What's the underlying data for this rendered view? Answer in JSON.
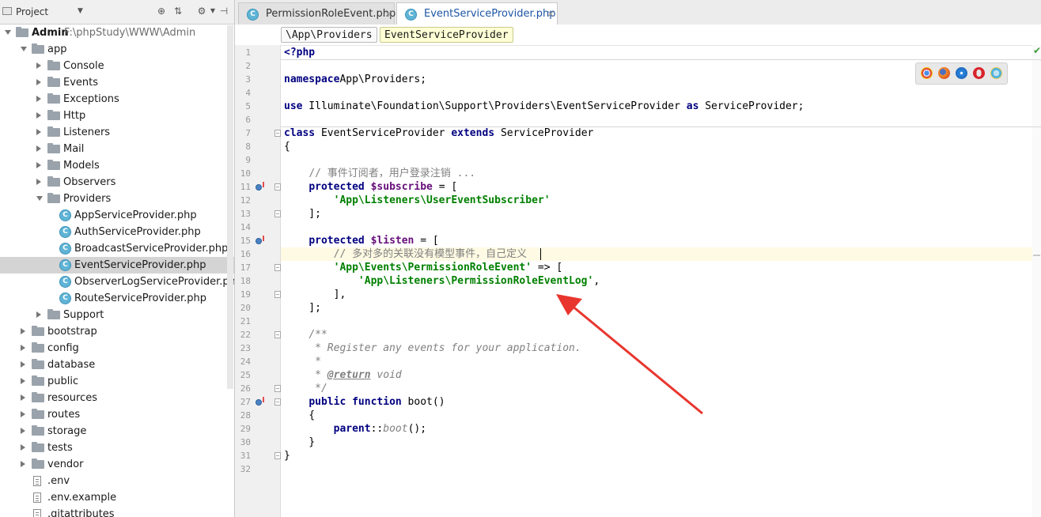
{
  "project_panel": {
    "title": "Project",
    "tree": [
      {
        "label": "Admin",
        "path": "F:\\phpStudy\\WWW\\Admin",
        "type": "folder",
        "open": true,
        "depth": 0,
        "root": true
      },
      {
        "label": "app",
        "type": "folder",
        "open": true,
        "depth": 1
      },
      {
        "label": "Console",
        "type": "folder",
        "open": false,
        "depth": 2
      },
      {
        "label": "Events",
        "type": "folder",
        "open": false,
        "depth": 2
      },
      {
        "label": "Exceptions",
        "type": "folder",
        "open": false,
        "depth": 2
      },
      {
        "label": "Http",
        "type": "folder",
        "open": false,
        "depth": 2
      },
      {
        "label": "Listeners",
        "type": "folder",
        "open": false,
        "depth": 2
      },
      {
        "label": "Mail",
        "type": "folder",
        "open": false,
        "depth": 2
      },
      {
        "label": "Models",
        "type": "folder",
        "open": false,
        "depth": 2
      },
      {
        "label": "Observers",
        "type": "folder",
        "open": false,
        "depth": 2
      },
      {
        "label": "Providers",
        "type": "folder",
        "open": true,
        "depth": 2
      },
      {
        "label": "AppServiceProvider.php",
        "type": "class",
        "depth": 3
      },
      {
        "label": "AuthServiceProvider.php",
        "type": "class",
        "depth": 3
      },
      {
        "label": "BroadcastServiceProvider.php",
        "type": "class",
        "depth": 3
      },
      {
        "label": "EventServiceProvider.php",
        "type": "class",
        "depth": 3,
        "selected": true
      },
      {
        "label": "ObserverLogServiceProvider.php",
        "type": "class",
        "depth": 3
      },
      {
        "label": "RouteServiceProvider.php",
        "type": "class",
        "depth": 3
      },
      {
        "label": "Support",
        "type": "folder",
        "open": false,
        "depth": 2
      },
      {
        "label": "bootstrap",
        "type": "folder",
        "open": false,
        "depth": 1
      },
      {
        "label": "config",
        "type": "folder",
        "open": false,
        "depth": 1
      },
      {
        "label": "database",
        "type": "folder",
        "open": false,
        "depth": 1
      },
      {
        "label": "public",
        "type": "folder",
        "open": false,
        "depth": 1
      },
      {
        "label": "resources",
        "type": "folder",
        "open": false,
        "depth": 1
      },
      {
        "label": "routes",
        "type": "folder",
        "open": false,
        "depth": 1
      },
      {
        "label": "storage",
        "type": "folder",
        "open": false,
        "depth": 1
      },
      {
        "label": "tests",
        "type": "folder",
        "open": false,
        "depth": 1
      },
      {
        "label": "vendor",
        "type": "folder",
        "open": false,
        "depth": 1
      },
      {
        "label": ".env",
        "type": "file",
        "depth": 1
      },
      {
        "label": ".env.example",
        "type": "file",
        "depth": 1
      },
      {
        "label": ".gitattributes",
        "type": "file",
        "depth": 1
      }
    ]
  },
  "tabs": [
    {
      "label": "PermissionRoleEvent.php",
      "active": false
    },
    {
      "label": "EventServiceProvider.php",
      "active": true
    }
  ],
  "breadcrumbs": [
    "\\App\\Providers",
    "EventServiceProvider"
  ],
  "code_lines": [
    {
      "n": "1",
      "t": [
        [
          "kw",
          "<?php"
        ]
      ]
    },
    {
      "n": "2",
      "t": []
    },
    {
      "n": "3",
      "t": [
        [
          "kw",
          "namespace"
        ],
        [
          "",
          "App\\Providers;"
        ]
      ]
    },
    {
      "n": "4",
      "t": []
    },
    {
      "n": "5",
      "t": [
        [
          "kw",
          "use"
        ],
        [
          "",
          " Illuminate\\Foundation\\Support\\Providers\\EventServiceProvider "
        ],
        [
          "kw",
          "as"
        ],
        [
          "",
          " ServiceProvider;"
        ]
      ]
    },
    {
      "n": "6",
      "t": []
    },
    {
      "n": "7",
      "t": [
        [
          "kw",
          "class"
        ],
        [
          "",
          " EventServiceProvider "
        ],
        [
          "kw",
          "extends"
        ],
        [
          "",
          " ServiceProvider"
        ]
      ]
    },
    {
      "n": "8",
      "t": [
        [
          "",
          "{"
        ]
      ]
    },
    {
      "n": "9",
      "t": []
    },
    {
      "n": "10",
      "t": [
        [
          "",
          "    "
        ],
        [
          "cmt",
          "// 事件订阅者，用户登录注销 ..."
        ]
      ]
    },
    {
      "n": "11",
      "t": [
        [
          "",
          "    "
        ],
        [
          "kw",
          "protected"
        ],
        [
          "",
          " "
        ],
        [
          "var",
          "$subscribe"
        ],
        [
          "",
          " = ["
        ]
      ]
    },
    {
      "n": "12",
      "t": [
        [
          "",
          "        "
        ],
        [
          "str",
          "'App\\Listeners\\UserEventSubscriber'"
        ]
      ]
    },
    {
      "n": "13",
      "t": [
        [
          "",
          "    ];"
        ]
      ]
    },
    {
      "n": "14",
      "t": []
    },
    {
      "n": "15",
      "t": [
        [
          "",
          "    "
        ],
        [
          "kw",
          "protected"
        ],
        [
          "",
          " "
        ],
        [
          "var",
          "$listen"
        ],
        [
          "",
          " = ["
        ]
      ]
    },
    {
      "n": "16",
      "t": [
        [
          "",
          "        "
        ],
        [
          "cmt",
          "// 多对多的关联没有模型事件，自己定义"
        ]
      ]
    },
    {
      "n": "17",
      "t": [
        [
          "",
          "        "
        ],
        [
          "str",
          "'App\\Events\\PermissionRoleEvent'"
        ],
        [
          "",
          " => ["
        ]
      ]
    },
    {
      "n": "18",
      "t": [
        [
          "",
          "            "
        ],
        [
          "str",
          "'App\\Listeners\\PermissionRoleEventLog'"
        ],
        [
          "",
          ","
        ]
      ]
    },
    {
      "n": "19",
      "t": [
        [
          "",
          "        ],"
        ]
      ]
    },
    {
      "n": "20",
      "t": [
        [
          "",
          "    ];"
        ]
      ]
    },
    {
      "n": "21",
      "t": []
    },
    {
      "n": "22",
      "t": [
        [
          "",
          "    "
        ],
        [
          "doccmt",
          "/**"
        ]
      ]
    },
    {
      "n": "23",
      "t": [
        [
          "",
          "     "
        ],
        [
          "doccmt",
          "* Register any events for your application."
        ]
      ]
    },
    {
      "n": "24",
      "t": [
        [
          "",
          "     "
        ],
        [
          "doccmt",
          "*"
        ]
      ]
    },
    {
      "n": "25",
      "t": [
        [
          "",
          "     "
        ],
        [
          "doccmt",
          "* "
        ],
        [
          "doctag",
          "@return"
        ],
        [
          "doccmt",
          " void"
        ]
      ]
    },
    {
      "n": "26",
      "t": [
        [
          "",
          "     "
        ],
        [
          "doccmt",
          "*/"
        ]
      ]
    },
    {
      "n": "27",
      "t": [
        [
          "",
          "    "
        ],
        [
          "kw",
          "public"
        ],
        [
          "",
          " "
        ],
        [
          "kw",
          "function"
        ],
        [
          "",
          " boot()"
        ]
      ]
    },
    {
      "n": "28",
      "t": [
        [
          "",
          "    {"
        ]
      ]
    },
    {
      "n": "29",
      "t": [
        [
          "",
          "        "
        ],
        [
          "kw",
          "parent"
        ],
        [
          "",
          "::"
        ],
        [
          "doccmt",
          "boot"
        ],
        [
          "",
          "();"
        ]
      ]
    },
    {
      "n": "30",
      "t": [
        [
          "",
          "    }"
        ]
      ]
    },
    {
      "n": "31",
      "t": [
        [
          "",
          "}"
        ]
      ]
    },
    {
      "n": "32",
      "t": []
    }
  ],
  "current_line": "16",
  "browsers": [
    "chrome-icon",
    "firefox-icon",
    "safari-icon",
    "opera-icon",
    "ie-icon"
  ],
  "colors": {
    "keyword": "#000080",
    "string": "#008000",
    "comment": "#808080",
    "variable": "#660e7a",
    "annotation_arrow": "#e8362e",
    "selection": "#d4d4d4"
  }
}
